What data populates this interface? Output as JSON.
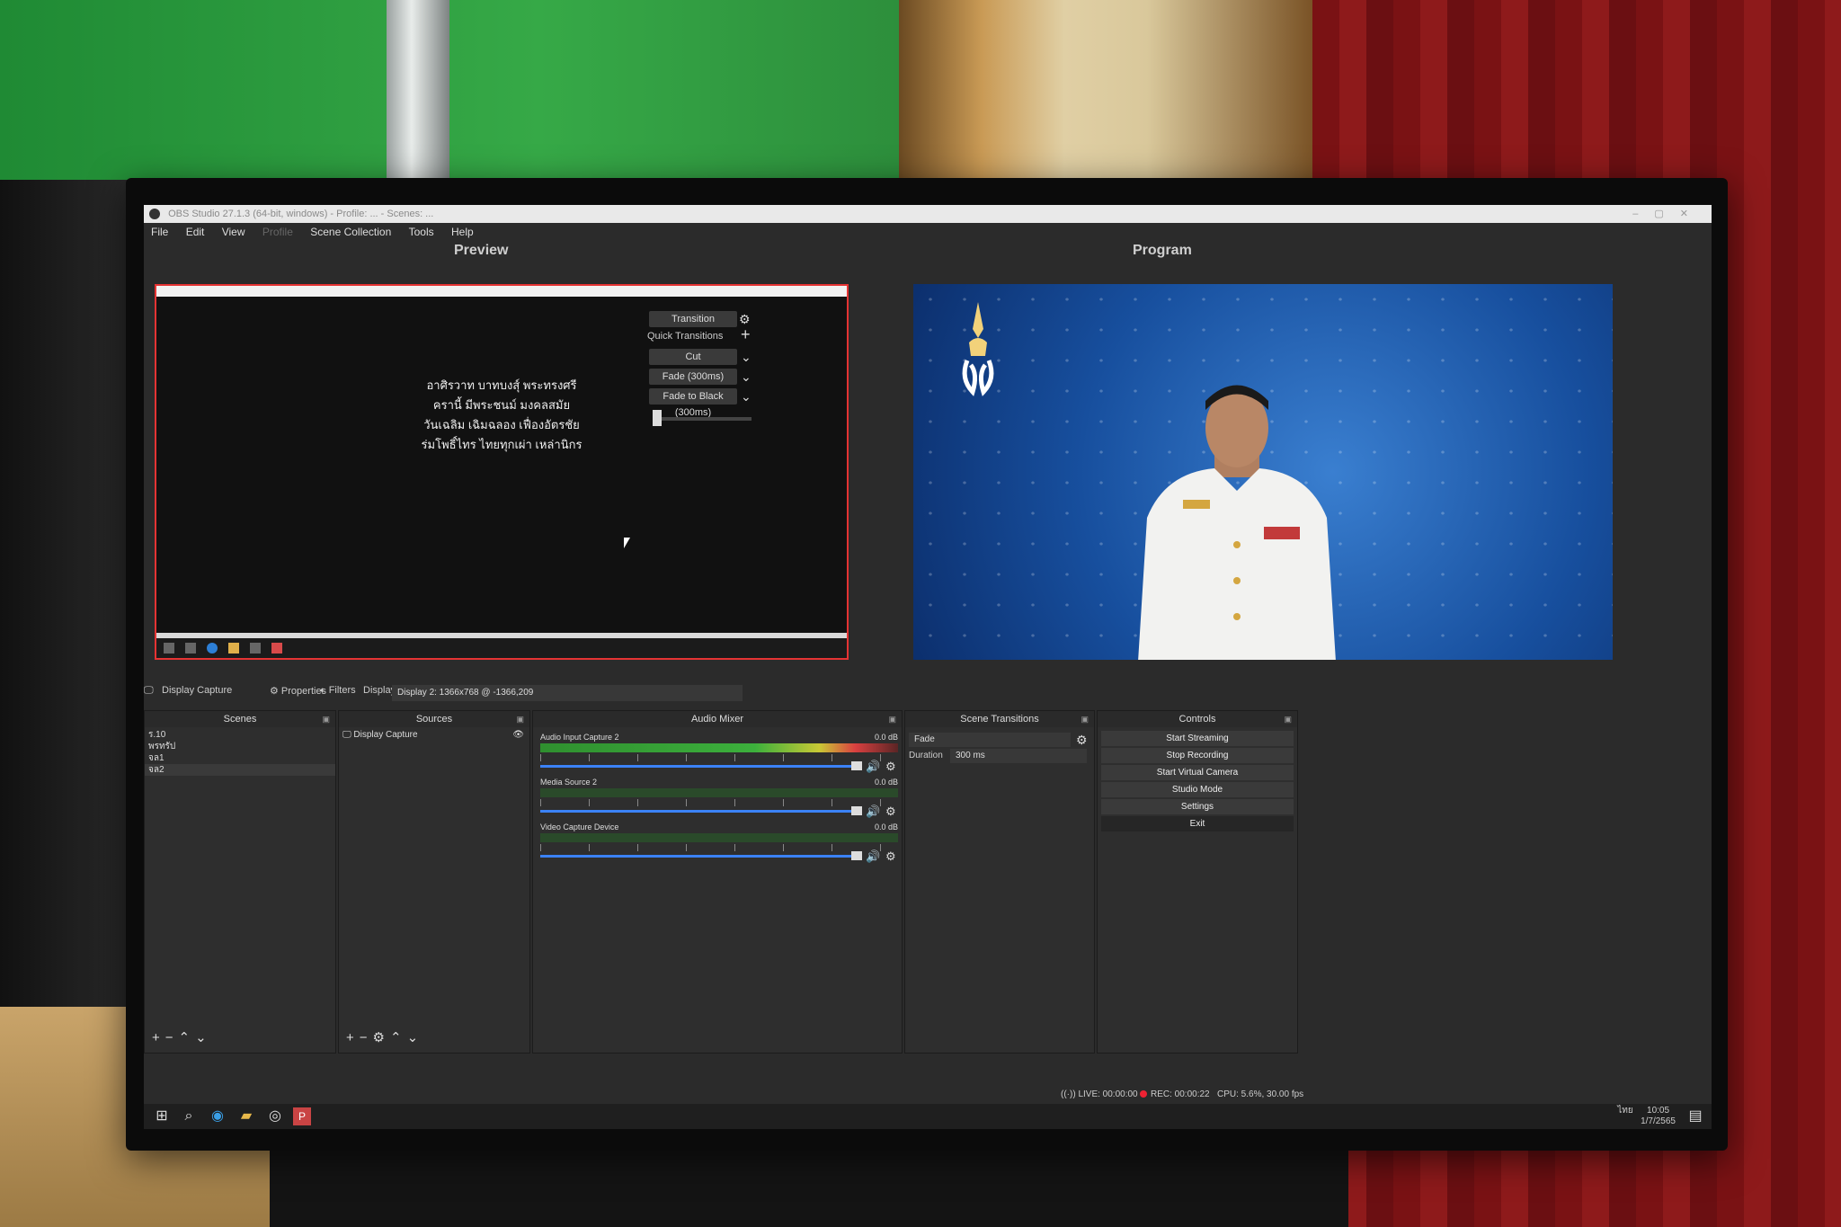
{
  "window": {
    "title": "OBS Studio 27.1.3 (64-bit, windows) - Profile: ... - Scenes: ..."
  },
  "menu": [
    "File",
    "Edit",
    "View",
    "Profile",
    "Scene Collection",
    "Tools",
    "Help"
  ],
  "preview": {
    "label": "Preview",
    "text_lines": [
      "อาศิรวาท บาทบงสุ์ พระทรงศรี",
      "ครานี้ มีพระชนม์ มงคลสมัย",
      "วันเฉลิม เฉิมฉลอง เฟื่องอัตรชัย",
      "ร่มโพธิ์ไทร ไทยทุกเผ่า เหล่านิกร"
    ]
  },
  "program": {
    "label": "Program"
  },
  "transitions": {
    "transition_button": "Transition",
    "quick_transitions_label": "Quick Transitions",
    "quick": [
      "Cut",
      "Fade (300ms)",
      "Fade to Black (300ms)"
    ]
  },
  "source_toolbar": {
    "source_name": "Display Capture",
    "properties": "Properties",
    "filters": "Filters",
    "display_label": "Display",
    "display_value": "Display 2: 1366x768 @ -1366,209"
  },
  "scenes": {
    "title": "Scenes",
    "items": [
      "ร.10",
      "พรทรัป",
      "จล1",
      "จล2"
    ]
  },
  "sources": {
    "title": "Sources",
    "items": [
      "Display Capture"
    ]
  },
  "audio_mixer": {
    "title": "Audio Mixer",
    "channels": [
      {
        "name": "Audio Input Capture 2",
        "db": "0.0 dB"
      },
      {
        "name": "Media Source 2",
        "db": "0.0 dB"
      },
      {
        "name": "Video Capture Device",
        "db": "0.0 dB"
      }
    ]
  },
  "scene_transitions": {
    "title": "Scene Transitions",
    "transition": "Fade",
    "duration_label": "Duration",
    "duration_value": "300 ms"
  },
  "controls": {
    "title": "Controls",
    "buttons": [
      "Start Streaming",
      "Stop Recording",
      "Start Virtual Camera",
      "Studio Mode",
      "Settings",
      "Exit"
    ]
  },
  "status": {
    "live": "LIVE: 00:00:00",
    "rec": "REC: 00:00:22",
    "cpu": "CPU: 5.6%, 30.00 fps"
  },
  "taskbar": {
    "time": "10:05",
    "date": "1/7/2565",
    "lang": "ไทย"
  },
  "colors": {
    "selection_border": "#e53333",
    "volume_slider": "#3b82f6",
    "rec_indicator": "#ee2233"
  }
}
